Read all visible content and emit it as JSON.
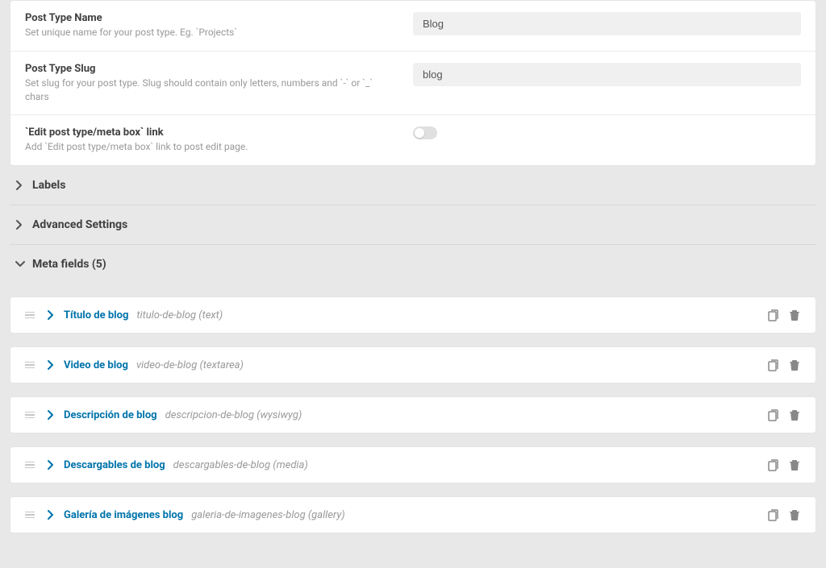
{
  "fields": {
    "post_type_name": {
      "label": "Post Type Name",
      "desc": "Set unique name for your post type. Eg. `Projects`",
      "value": "Blog"
    },
    "post_type_slug": {
      "label": "Post Type Slug",
      "desc": "Set slug for your post type. Slug should contain only letters, numbers and `-` or `_` chars",
      "value": "blog"
    },
    "edit_link": {
      "label": "`Edit post type/meta box` link",
      "desc": "Add `Edit post type/meta box` link to post edit page."
    }
  },
  "sections": {
    "labels": "Labels",
    "advanced": "Advanced Settings",
    "meta_fields": "Meta fields (5)"
  },
  "meta": [
    {
      "name": "Título de blog",
      "slug": "titulo-de-blog (text)"
    },
    {
      "name": "Video de blog",
      "slug": "video-de-blog (textarea)"
    },
    {
      "name": "Descripción de blog",
      "slug": "descripcion-de-blog (wysiwyg)"
    },
    {
      "name": "Descargables de blog",
      "slug": "descargables-de-blog (media)"
    },
    {
      "name": "Galería de imágenes blog",
      "slug": "galeria-de-imagenes-blog (gallery)"
    }
  ]
}
